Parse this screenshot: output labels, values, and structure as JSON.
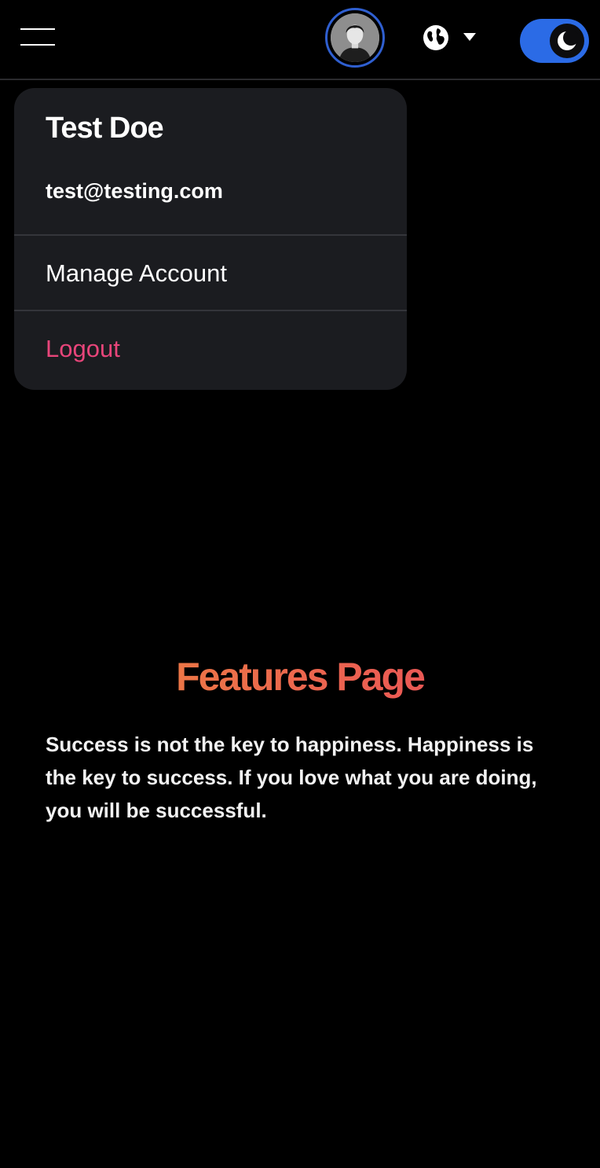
{
  "header": {
    "menu_icon": "hamburger-menu-icon",
    "avatar_icon": "user-avatar-icon",
    "language_icon": "globe-icon",
    "language_caret_icon": "caret-down-icon",
    "theme_icon": "moon-icon",
    "theme_dark_enabled": true,
    "accent_color": "#2b6be6"
  },
  "account_menu": {
    "name": "Test Doe",
    "email": "test@testing.com",
    "items": [
      {
        "label": "Manage Account",
        "color": "#ffffff"
      },
      {
        "label": "Logout",
        "color": "#e8457a"
      }
    ]
  },
  "main": {
    "title": "Features Page",
    "title_gradient": [
      "#ee8a3c",
      "#e9445f"
    ],
    "quote": "Success is not the key to happiness. Happiness is the key to success. If you love what you are doing, you will be successful."
  }
}
